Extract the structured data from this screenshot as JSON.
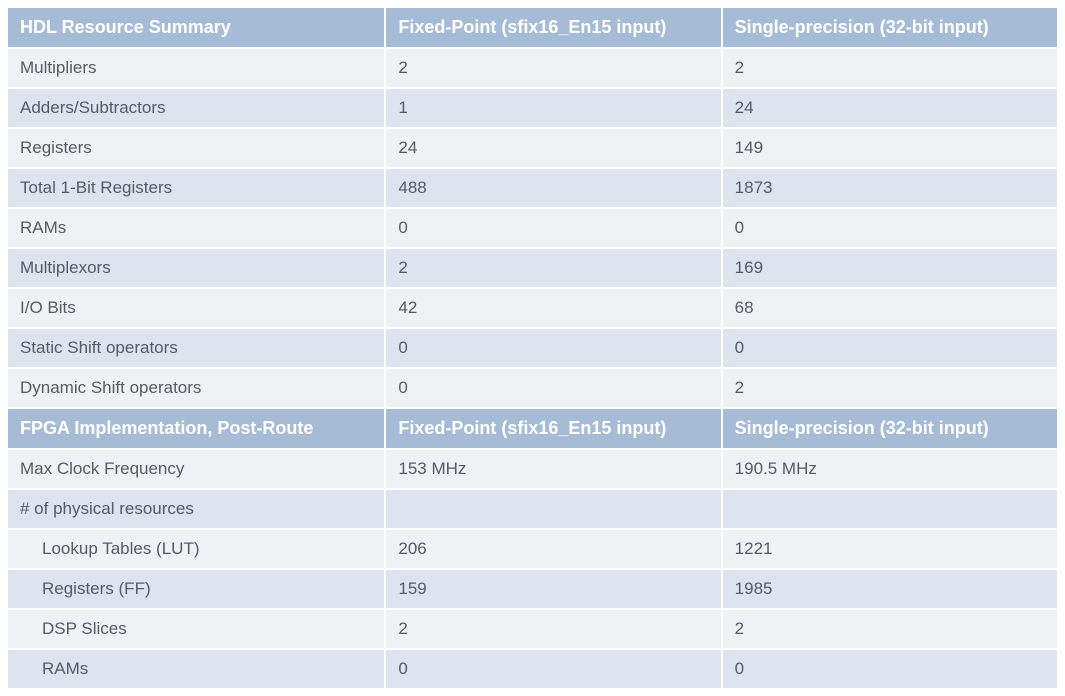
{
  "section1": {
    "headers": [
      "HDL Resource Summary",
      "Fixed-Point (sfix16_En15 input)",
      "Single-precision (32-bit input)"
    ],
    "rows": [
      {
        "label": "Multipliers",
        "c1": "2",
        "c2": "2"
      },
      {
        "label": "Adders/Subtractors",
        "c1": "1",
        "c2": "24"
      },
      {
        "label": "Registers",
        "c1": "24",
        "c2": "149"
      },
      {
        "label": "Total 1-Bit Registers",
        "c1": "488",
        "c2": "1873"
      },
      {
        "label": "RAMs",
        "c1": "0",
        "c2": "0"
      },
      {
        "label": "Multiplexors",
        "c1": "2",
        "c2": "169"
      },
      {
        "label": "I/O Bits",
        "c1": "42",
        "c2": "68"
      },
      {
        "label": "Static Shift operators",
        "c1": "0",
        "c2": "0"
      },
      {
        "label": "Dynamic Shift operators",
        "c1": "0",
        "c2": "2"
      }
    ]
  },
  "section2": {
    "headers": [
      "FPGA Implementation, Post-Route",
      "Fixed-Point (sfix16_En15 input)",
      "Single-precision (32-bit input)"
    ],
    "rows": [
      {
        "label": "Max Clock Frequency",
        "c1": "153 MHz",
        "c2": "190.5 MHz",
        "indent": false
      },
      {
        "label": "# of physical resources",
        "c1": "",
        "c2": "",
        "indent": false
      },
      {
        "label": "Lookup Tables (LUT)",
        "c1": "206",
        "c2": "1221",
        "indent": true
      },
      {
        "label": "Registers (FF)",
        "c1": "159",
        "c2": "1985",
        "indent": true
      },
      {
        "label": "DSP Slices",
        "c1": "2",
        "c2": "2",
        "indent": true
      },
      {
        "label": "RAMs",
        "c1": "0",
        "c2": "0",
        "indent": true
      }
    ]
  }
}
